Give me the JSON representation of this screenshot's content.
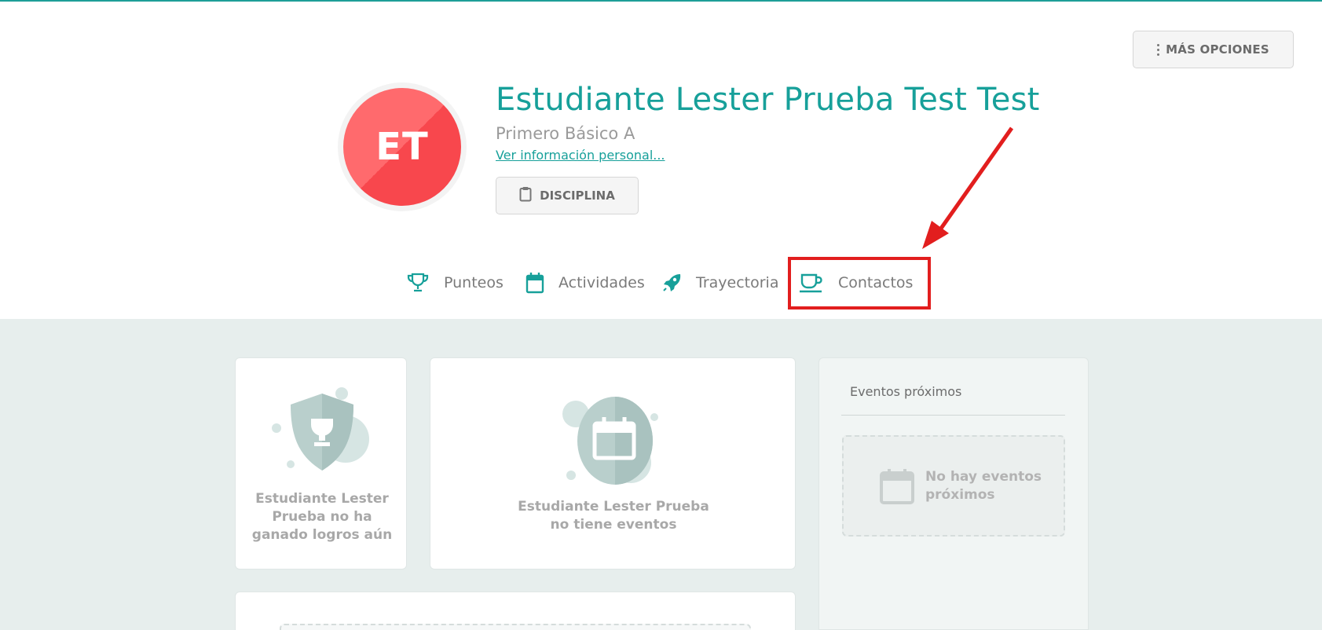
{
  "header": {
    "more_options_label": "MÁS OPCIONES",
    "avatar_initials": "ET",
    "student_name": "Estudiante Lester Prueba Test Test",
    "grade": "Primero Básico A",
    "personal_info_link": "Ver información personal...",
    "discipline_label": "DISCIPLINA"
  },
  "tabs": [
    {
      "label": "Punteos",
      "icon": "trophy-icon"
    },
    {
      "label": "Actividades",
      "icon": "calendar-icon"
    },
    {
      "label": "Trayectoria",
      "icon": "rocket-icon"
    },
    {
      "label": "Contactos",
      "icon": "coffee-cup-icon"
    }
  ],
  "cards": {
    "achievements_empty": "Estudiante Lester Prueba no ha ganado logros aún",
    "events_empty": "Estudiante Lester Prueba no tiene eventos"
  },
  "upcoming": {
    "title": "Eventos próximos",
    "empty_text": "No hay eventos próximos"
  },
  "colors": {
    "accent": "#17a09a",
    "avatar": "#f8474d",
    "highlight": "#e21e1e",
    "content_bg": "#e7eeed"
  }
}
